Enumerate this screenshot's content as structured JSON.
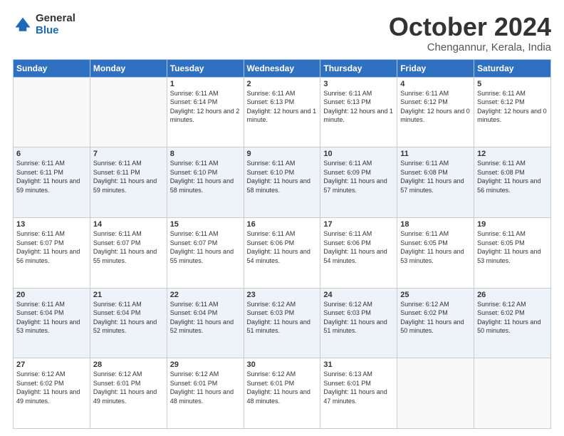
{
  "logo": {
    "general": "General",
    "blue": "Blue"
  },
  "title": "October 2024",
  "location": "Chengannur, Kerala, India",
  "header_days": [
    "Sunday",
    "Monday",
    "Tuesday",
    "Wednesday",
    "Thursday",
    "Friday",
    "Saturday"
  ],
  "weeks": [
    [
      {
        "day": "",
        "sunrise": "",
        "sunset": "",
        "daylight": ""
      },
      {
        "day": "",
        "sunrise": "",
        "sunset": "",
        "daylight": ""
      },
      {
        "day": "1",
        "sunrise": "Sunrise: 6:11 AM",
        "sunset": "Sunset: 6:14 PM",
        "daylight": "Daylight: 12 hours and 2 minutes."
      },
      {
        "day": "2",
        "sunrise": "Sunrise: 6:11 AM",
        "sunset": "Sunset: 6:13 PM",
        "daylight": "Daylight: 12 hours and 1 minute."
      },
      {
        "day": "3",
        "sunrise": "Sunrise: 6:11 AM",
        "sunset": "Sunset: 6:13 PM",
        "daylight": "Daylight: 12 hours and 1 minute."
      },
      {
        "day": "4",
        "sunrise": "Sunrise: 6:11 AM",
        "sunset": "Sunset: 6:12 PM",
        "daylight": "Daylight: 12 hours and 0 minutes."
      },
      {
        "day": "5",
        "sunrise": "Sunrise: 6:11 AM",
        "sunset": "Sunset: 6:12 PM",
        "daylight": "Daylight: 12 hours and 0 minutes."
      }
    ],
    [
      {
        "day": "6",
        "sunrise": "Sunrise: 6:11 AM",
        "sunset": "Sunset: 6:11 PM",
        "daylight": "Daylight: 11 hours and 59 minutes."
      },
      {
        "day": "7",
        "sunrise": "Sunrise: 6:11 AM",
        "sunset": "Sunset: 6:11 PM",
        "daylight": "Daylight: 11 hours and 59 minutes."
      },
      {
        "day": "8",
        "sunrise": "Sunrise: 6:11 AM",
        "sunset": "Sunset: 6:10 PM",
        "daylight": "Daylight: 11 hours and 58 minutes."
      },
      {
        "day": "9",
        "sunrise": "Sunrise: 6:11 AM",
        "sunset": "Sunset: 6:10 PM",
        "daylight": "Daylight: 11 hours and 58 minutes."
      },
      {
        "day": "10",
        "sunrise": "Sunrise: 6:11 AM",
        "sunset": "Sunset: 6:09 PM",
        "daylight": "Daylight: 11 hours and 57 minutes."
      },
      {
        "day": "11",
        "sunrise": "Sunrise: 6:11 AM",
        "sunset": "Sunset: 6:08 PM",
        "daylight": "Daylight: 11 hours and 57 minutes."
      },
      {
        "day": "12",
        "sunrise": "Sunrise: 6:11 AM",
        "sunset": "Sunset: 6:08 PM",
        "daylight": "Daylight: 11 hours and 56 minutes."
      }
    ],
    [
      {
        "day": "13",
        "sunrise": "Sunrise: 6:11 AM",
        "sunset": "Sunset: 6:07 PM",
        "daylight": "Daylight: 11 hours and 56 minutes."
      },
      {
        "day": "14",
        "sunrise": "Sunrise: 6:11 AM",
        "sunset": "Sunset: 6:07 PM",
        "daylight": "Daylight: 11 hours and 55 minutes."
      },
      {
        "day": "15",
        "sunrise": "Sunrise: 6:11 AM",
        "sunset": "Sunset: 6:07 PM",
        "daylight": "Daylight: 11 hours and 55 minutes."
      },
      {
        "day": "16",
        "sunrise": "Sunrise: 6:11 AM",
        "sunset": "Sunset: 6:06 PM",
        "daylight": "Daylight: 11 hours and 54 minutes."
      },
      {
        "day": "17",
        "sunrise": "Sunrise: 6:11 AM",
        "sunset": "Sunset: 6:06 PM",
        "daylight": "Daylight: 11 hours and 54 minutes."
      },
      {
        "day": "18",
        "sunrise": "Sunrise: 6:11 AM",
        "sunset": "Sunset: 6:05 PM",
        "daylight": "Daylight: 11 hours and 53 minutes."
      },
      {
        "day": "19",
        "sunrise": "Sunrise: 6:11 AM",
        "sunset": "Sunset: 6:05 PM",
        "daylight": "Daylight: 11 hours and 53 minutes."
      }
    ],
    [
      {
        "day": "20",
        "sunrise": "Sunrise: 6:11 AM",
        "sunset": "Sunset: 6:04 PM",
        "daylight": "Daylight: 11 hours and 53 minutes."
      },
      {
        "day": "21",
        "sunrise": "Sunrise: 6:11 AM",
        "sunset": "Sunset: 6:04 PM",
        "daylight": "Daylight: 11 hours and 52 minutes."
      },
      {
        "day": "22",
        "sunrise": "Sunrise: 6:11 AM",
        "sunset": "Sunset: 6:04 PM",
        "daylight": "Daylight: 11 hours and 52 minutes."
      },
      {
        "day": "23",
        "sunrise": "Sunrise: 6:12 AM",
        "sunset": "Sunset: 6:03 PM",
        "daylight": "Daylight: 11 hours and 51 minutes."
      },
      {
        "day": "24",
        "sunrise": "Sunrise: 6:12 AM",
        "sunset": "Sunset: 6:03 PM",
        "daylight": "Daylight: 11 hours and 51 minutes."
      },
      {
        "day": "25",
        "sunrise": "Sunrise: 6:12 AM",
        "sunset": "Sunset: 6:02 PM",
        "daylight": "Daylight: 11 hours and 50 minutes."
      },
      {
        "day": "26",
        "sunrise": "Sunrise: 6:12 AM",
        "sunset": "Sunset: 6:02 PM",
        "daylight": "Daylight: 11 hours and 50 minutes."
      }
    ],
    [
      {
        "day": "27",
        "sunrise": "Sunrise: 6:12 AM",
        "sunset": "Sunset: 6:02 PM",
        "daylight": "Daylight: 11 hours and 49 minutes."
      },
      {
        "day": "28",
        "sunrise": "Sunrise: 6:12 AM",
        "sunset": "Sunset: 6:01 PM",
        "daylight": "Daylight: 11 hours and 49 minutes."
      },
      {
        "day": "29",
        "sunrise": "Sunrise: 6:12 AM",
        "sunset": "Sunset: 6:01 PM",
        "daylight": "Daylight: 11 hours and 48 minutes."
      },
      {
        "day": "30",
        "sunrise": "Sunrise: 6:12 AM",
        "sunset": "Sunset: 6:01 PM",
        "daylight": "Daylight: 11 hours and 48 minutes."
      },
      {
        "day": "31",
        "sunrise": "Sunrise: 6:13 AM",
        "sunset": "Sunset: 6:01 PM",
        "daylight": "Daylight: 11 hours and 47 minutes."
      },
      {
        "day": "",
        "sunrise": "",
        "sunset": "",
        "daylight": ""
      },
      {
        "day": "",
        "sunrise": "",
        "sunset": "",
        "daylight": ""
      }
    ]
  ]
}
